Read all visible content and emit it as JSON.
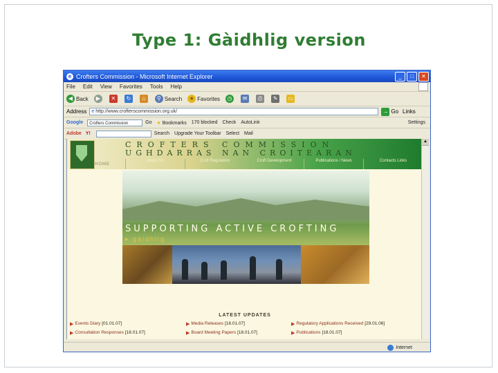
{
  "slide": {
    "title": "Type 1: Gàidhlig version"
  },
  "window": {
    "title": "Crofters Commission - Microsoft Internet Explorer"
  },
  "menu": [
    "File",
    "Edit",
    "View",
    "Favorites",
    "Tools",
    "Help"
  ],
  "toolbar": {
    "back": "Back",
    "search": "Search",
    "favorites": "Favorites"
  },
  "address": {
    "label": "Address",
    "url": "http://www.crofterscommission.org.uk/",
    "go": "Go",
    "links": "Links"
  },
  "google": {
    "label": "Google",
    "query": "Crofters Commission",
    "go": "Go",
    "bookmarks": "Bookmarks",
    "blocked": "170 blocked",
    "check": "Check",
    "autolink": "AutoLink",
    "settings": "Settings"
  },
  "adobe": {
    "label": "Adobe",
    "search": "Search",
    "upgrade": "Upgrade Your Toolbar",
    "select": "Select",
    "mail": "Mail"
  },
  "site": {
    "brand_en": "CROFTERS COMMISSION",
    "brand_gd": "UGHDARRAS NAN CROITEARAN",
    "home": "HOME",
    "nav": [
      "About Us",
      "Croft Regulation",
      "Croft Development",
      "Publications / News",
      "Contacts Links"
    ],
    "tagline": "SUPPORTING ACTIVE CROFTING",
    "language_link": "gàidhlig"
  },
  "updates": {
    "heading": "LATEST UPDATES",
    "items": [
      {
        "link": "Events Diary",
        "date": "[01.01.07]"
      },
      {
        "link": "Media Releases",
        "date": "[18.01.07]"
      },
      {
        "link": "Regulatory Applications Received",
        "date": "[29.01.06]"
      },
      {
        "link": "Consultation Responses",
        "date": "[18.01.07]"
      },
      {
        "link": "Board Meeting Papers",
        "date": "[18.01.07]"
      },
      {
        "link": "Publications",
        "date": "[18.01.07]"
      }
    ]
  },
  "status": {
    "zone": "Internet"
  },
  "colors": {
    "title_green": "#2f7d32",
    "xp_blue": "#1e56d6",
    "header_green": "#1e7b2e"
  }
}
